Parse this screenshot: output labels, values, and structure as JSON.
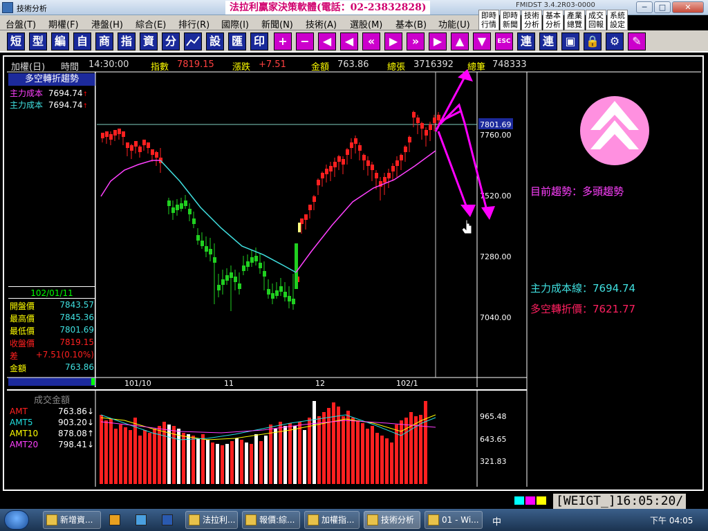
{
  "window": {
    "title": "技術分析",
    "banner": "法拉利贏家決策軟體(電話：02-23832828)",
    "version": "FMIDST 3.4.2R03-0000"
  },
  "quick_buttons": [
    "即時行情",
    "即時新聞",
    "技術分析",
    "基本分析",
    "產業總覽",
    "成交回報",
    "系統設定"
  ],
  "menu": [
    "台盤(T)",
    "期權(F)",
    "港盤(H)",
    "綜合(E)",
    "排行(R)",
    "國際(I)",
    "新聞(N)",
    "技術(A)",
    "選股(M)",
    "基本(B)",
    "功能(U)"
  ],
  "toolbar": [
    "短",
    "型",
    "編",
    "自",
    "商",
    "指",
    "資",
    "分",
    "",
    "設",
    "匯",
    "印",
    "+",
    "−",
    "◀",
    "◀",
    "«",
    "▶",
    "»",
    "▶",
    "▲",
    "▼",
    "",
    "連",
    "連",
    "",
    "",
    "",
    ""
  ],
  "info": {
    "symbol": "加權(日)",
    "time_label": "時間",
    "time": "14:30:00",
    "index_label": "指數",
    "index": "7819.15",
    "change_label": "漲跌",
    "change": "+7.51",
    "amount_label": "金額",
    "amount": "763.86",
    "total_label": "總張",
    "total": "3716392",
    "deals_label": "總筆",
    "deals": "748333"
  },
  "left": {
    "trend_header": "多空轉折趨勢",
    "cost1_label": "主力成本",
    "cost1": "7694.74",
    "cost2_label": "主力成本",
    "cost2": "7694.74",
    "date": "102/01/11",
    "ohlc": [
      {
        "label": "開盤價",
        "value": "7843.57"
      },
      {
        "label": "最高價",
        "value": "7845.36"
      },
      {
        "label": "最低價",
        "value": "7801.69"
      },
      {
        "label": "收盤價",
        "value": "7819.15"
      },
      {
        "label": "差",
        "value": "+7.51(0.10%)"
      },
      {
        "label": "金額",
        "value": "763.86"
      }
    ]
  },
  "chart": {
    "price_ticks": [
      "7801.69",
      "7760.00",
      "7520.00",
      "7280.00",
      "7040.00"
    ],
    "date_ticks": [
      "101/10",
      "11",
      "12",
      "102/1"
    ],
    "vol_ticks": [
      "965.48",
      "643.65",
      "321.83"
    ]
  },
  "right": {
    "trend_label": "目前趨勢：",
    "trend_value": "多頭趨勢",
    "cost_label": "主力成本線：",
    "cost_value": "7694.74",
    "turn_label": "多空轉折價：",
    "turn_value": "7621.77"
  },
  "volume": {
    "header": "成交金額",
    "rows": [
      {
        "label": "AMT",
        "value": "763.86↓",
        "color": "#ff2020"
      },
      {
        "label": "AMT5",
        "value": "903.20↓",
        "color": "#20e0e0"
      },
      {
        "label": "AMT10",
        "value": "878.08↑",
        "color": "#ffff00"
      },
      {
        "label": "AMT20",
        "value": "798.41↓",
        "color": "#ff40ff"
      }
    ]
  },
  "status": {
    "clock": "[WEIGT_]16:05:20/"
  },
  "taskbar": {
    "tasks": [
      "新增資...",
      "法拉利...",
      "報價:綜...",
      "加權指...",
      "技術分析",
      "01 - Wi..."
    ],
    "ime": "中",
    "time": "下午 04:05"
  },
  "colors": {
    "up": "#ff2020",
    "down": "#20d020",
    "ma_pink": "#ff40ff",
    "ma_cyan": "#40e0e0",
    "annot": "#ff00ff"
  }
}
